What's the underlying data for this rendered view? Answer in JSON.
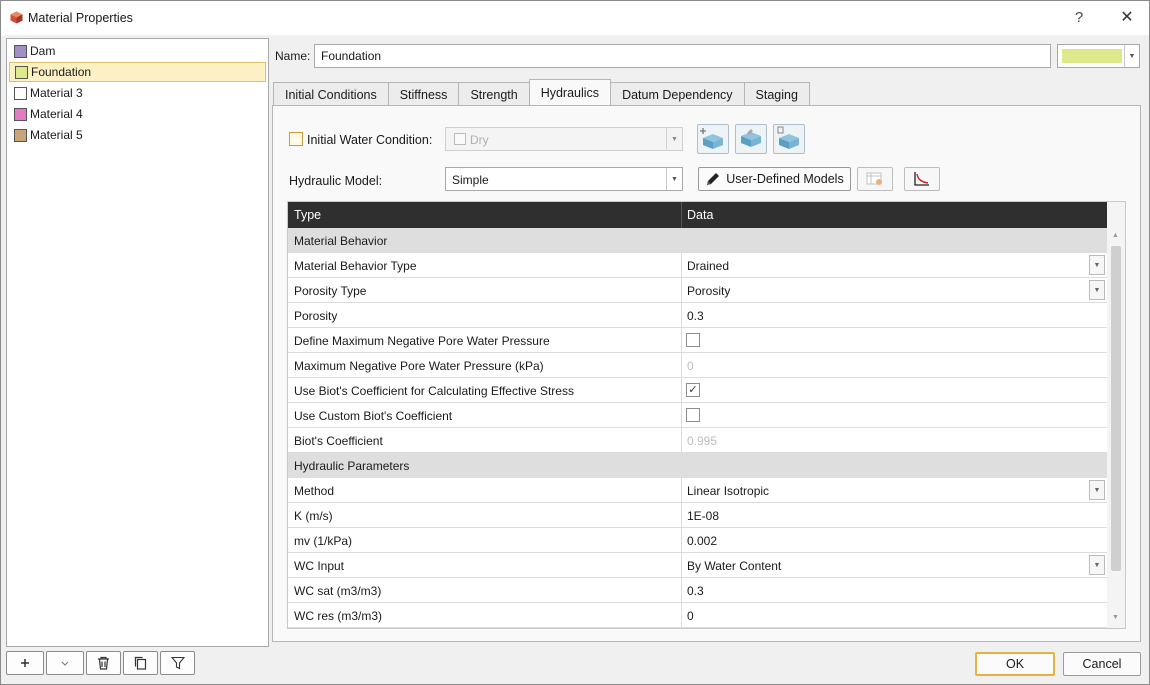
{
  "window": {
    "title": "Material Properties",
    "help_label": "?",
    "close_label": "✕"
  },
  "materials": [
    {
      "name": "Dam",
      "color": "#a18fc6",
      "selected": false
    },
    {
      "name": "Foundation",
      "color": "#dde98a",
      "selected": true
    },
    {
      "name": "Material 3",
      "color": "#ffffff",
      "selected": false
    },
    {
      "name": "Material 4",
      "color": "#e27bc4",
      "selected": false
    },
    {
      "name": "Material 5",
      "color": "#c9a67a",
      "selected": false
    }
  ],
  "name_field": {
    "label": "Name:",
    "value": "Foundation",
    "color": "#dde98a"
  },
  "tabs": [
    "Initial Conditions",
    "Stiffness",
    "Strength",
    "Hydraulics",
    "Datum Dependency",
    "Staging"
  ],
  "active_tab": "Hydraulics",
  "initial_water": {
    "label": "Initial Water Condition:",
    "value": "Dry"
  },
  "hydraulic_model": {
    "label": "Hydraulic Model:",
    "value": "Simple",
    "button_label": "User-Defined Models"
  },
  "grid": {
    "headers": {
      "type": "Type",
      "data": "Data"
    },
    "rows": [
      {
        "kind": "group",
        "label": "Material Behavior"
      },
      {
        "label": "Material Behavior Type",
        "value": "Drained",
        "control": "dropdown"
      },
      {
        "label": "Porosity Type",
        "value": "Porosity",
        "control": "dropdown"
      },
      {
        "label": "Porosity",
        "value": "0.3",
        "control": "text"
      },
      {
        "label": "Define Maximum Negative Pore Water Pressure",
        "checked": false,
        "control": "checkbox"
      },
      {
        "label": "Maximum Negative Pore Water Pressure (kPa)",
        "value": "0",
        "control": "text",
        "muted": true
      },
      {
        "label": "Use Biot's Coefficient for Calculating Effective Stress",
        "checked": true,
        "control": "checkbox"
      },
      {
        "label": "Use Custom Biot's Coefficient",
        "checked": false,
        "control": "checkbox"
      },
      {
        "label": "Biot's Coefficient",
        "value": "0.995",
        "control": "text",
        "muted": true
      },
      {
        "kind": "group",
        "label": "Hydraulic Parameters"
      },
      {
        "label": "Method",
        "value": "Linear Isotropic",
        "control": "dropdown"
      },
      {
        "label": "K (m/s)",
        "value": "1E-08",
        "control": "text"
      },
      {
        "label": "mv (1/kPa)",
        "value": "0.002",
        "control": "text"
      },
      {
        "label": "WC Input",
        "value": "By Water Content",
        "control": "dropdown"
      },
      {
        "label": "WC sat (m3/m3)",
        "value": "0.3",
        "control": "text"
      },
      {
        "label": "WC res (m3/m3)",
        "value": "0",
        "control": "text"
      }
    ]
  },
  "footer": {
    "ok_label": "OK",
    "cancel_label": "Cancel"
  }
}
